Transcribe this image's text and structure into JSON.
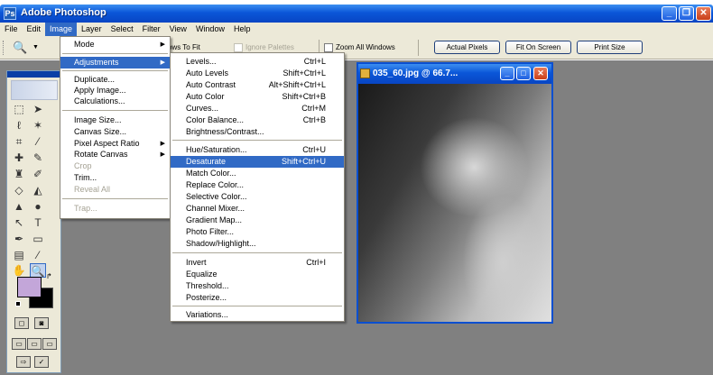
{
  "app": {
    "title": "Adobe Photoshop",
    "icon": "photoshop-icon",
    "window_buttons": [
      "minimize",
      "restore",
      "close"
    ]
  },
  "menubar": [
    "File",
    "Edit",
    "Image",
    "Layer",
    "Select",
    "Filter",
    "View",
    "Window",
    "Help"
  ],
  "options_bar": {
    "zoom_tool_icon": "magnifier-icon",
    "resize_windows_label": "ows To Fit",
    "ignore_palettes_label": "Ignore Palettes",
    "zoom_all_windows_label": "Zoom All Windows",
    "actual_pixels": "Actual Pixels",
    "fit_on_screen": "Fit On Screen",
    "print_size": "Print Size"
  },
  "image_menu": {
    "items": [
      {
        "label": "Mode",
        "submenu": true
      },
      {
        "label": "Adjustments",
        "submenu": true,
        "highlighted": true
      },
      {
        "label": "Duplicate..."
      },
      {
        "label": "Apply Image..."
      },
      {
        "label": "Calculations..."
      },
      {
        "label": "Image Size..."
      },
      {
        "label": "Canvas Size..."
      },
      {
        "label": "Pixel Aspect Ratio",
        "submenu": true
      },
      {
        "label": "Rotate Canvas",
        "submenu": true
      },
      {
        "label": "Crop",
        "disabled": true
      },
      {
        "label": "Trim..."
      },
      {
        "label": "Reveal All",
        "disabled": true
      },
      {
        "label": "Trap...",
        "disabled": true
      }
    ]
  },
  "adjustments_menu": {
    "items": [
      {
        "label": "Levels...",
        "shortcut": "Ctrl+L"
      },
      {
        "label": "Auto Levels",
        "shortcut": "Shift+Ctrl+L"
      },
      {
        "label": "Auto Contrast",
        "shortcut": "Alt+Shift+Ctrl+L"
      },
      {
        "label": "Auto Color",
        "shortcut": "Shift+Ctrl+B"
      },
      {
        "label": "Curves...",
        "shortcut": "Ctrl+M"
      },
      {
        "label": "Color Balance...",
        "shortcut": "Ctrl+B"
      },
      {
        "label": "Brightness/Contrast...",
        "shortcut": ""
      },
      {
        "label": "Hue/Saturation...",
        "shortcut": "Ctrl+U"
      },
      {
        "label": "Desaturate",
        "shortcut": "Shift+Ctrl+U",
        "highlighted": true
      },
      {
        "label": "Match Color...",
        "shortcut": ""
      },
      {
        "label": "Replace Color...",
        "shortcut": ""
      },
      {
        "label": "Selective Color...",
        "shortcut": ""
      },
      {
        "label": "Channel Mixer...",
        "shortcut": ""
      },
      {
        "label": "Gradient Map...",
        "shortcut": ""
      },
      {
        "label": "Photo Filter...",
        "shortcut": ""
      },
      {
        "label": "Shadow/Highlight...",
        "shortcut": ""
      },
      {
        "label": "Invert",
        "shortcut": "Ctrl+I"
      },
      {
        "label": "Equalize",
        "shortcut": ""
      },
      {
        "label": "Threshold...",
        "shortcut": ""
      },
      {
        "label": "Posterize...",
        "shortcut": ""
      },
      {
        "label": "Variations...",
        "shortcut": ""
      }
    ]
  },
  "document": {
    "title": "035_60.jpg @ 66.7...",
    "icon": "image-file-icon",
    "image": "grayscale-portrait-photo"
  },
  "colors": {
    "title_bar": "#0a56d8",
    "menu_highlight": "#316ac5",
    "workspace": "#808080",
    "foreground_swatch": "#c3a6d9",
    "background_swatch": "#000000",
    "panel": "#ece9d8"
  }
}
